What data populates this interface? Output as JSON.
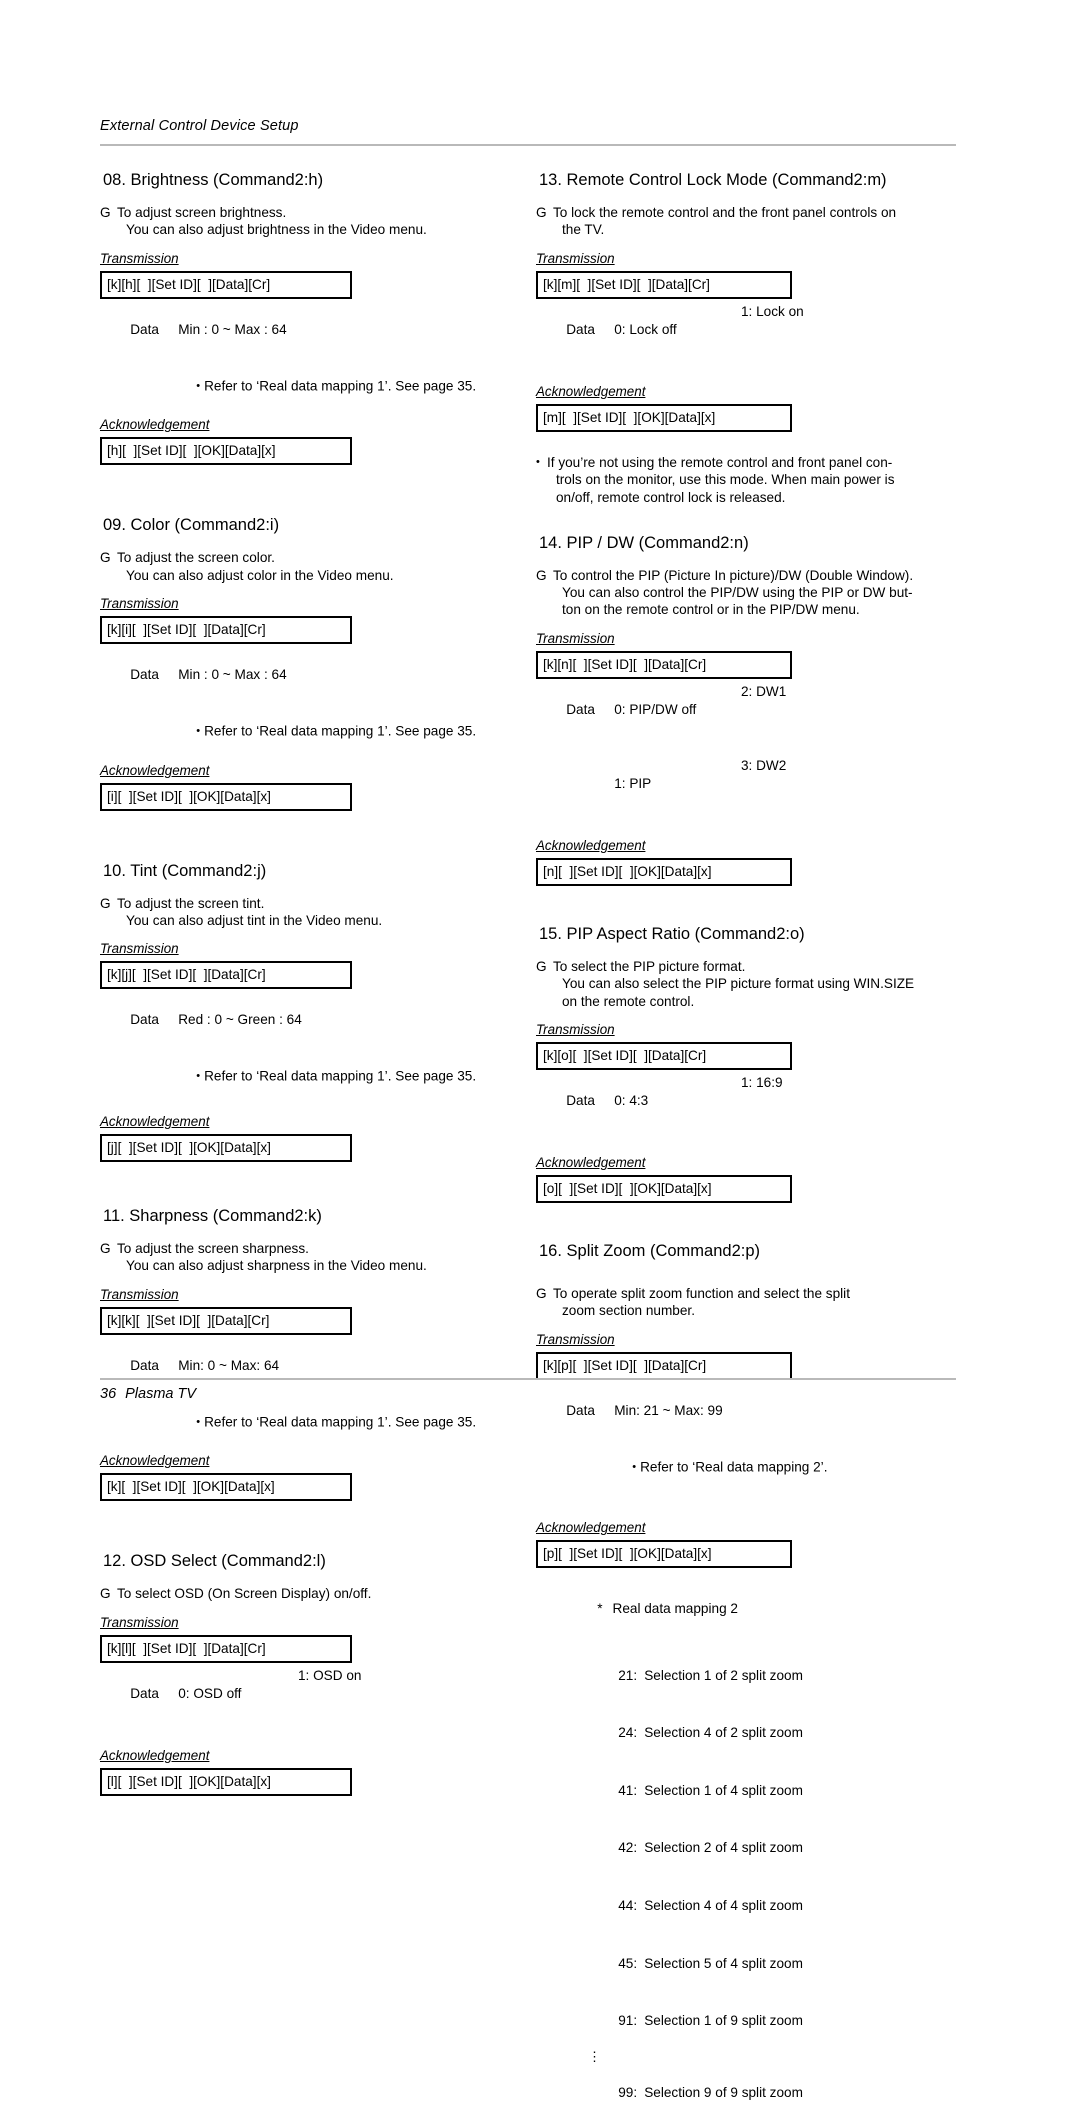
{
  "header": {
    "running_title": "External Control Device Setup"
  },
  "footer": {
    "page_number": "36",
    "product": "Plasma TV"
  },
  "labels": {
    "transmission": "Transmission",
    "acknowledgement": "Acknowledgement",
    "g_mark": "G",
    "bullet": "•",
    "star": "*",
    "data": "Data"
  },
  "left_column": [
    {
      "title": "08. Brightness (Command2:h)",
      "desc_line1": "To adjust screen brightness.",
      "desc_line2": "You can also adjust brightness in the Video menu.",
      "transmission": "[k][h][  ][Set ID][  ][Data][Cr]",
      "data_label": "Data",
      "data_value": "Min : 0 ~ Max : 64",
      "refer": "Refer to ‘Real data mapping 1’. See page 35.",
      "acknowledgement": "[h][  ][Set ID][  ][OK][Data][x]"
    },
    {
      "title": "09. Color (Command2:i)",
      "desc_line1": "To adjust the screen color.",
      "desc_line2": "You can also adjust color in the Video menu.",
      "transmission": "[k][i][  ][Set ID][  ][Data][Cr]",
      "data_label": "Data",
      "data_value": "Min : 0 ~ Max : 64",
      "refer": "Refer to ‘Real data mapping 1’. See page 35.",
      "acknowledgement": "[i][  ][Set ID][  ][OK][Data][x]"
    },
    {
      "title": "10. Tint (Command2:j)",
      "desc_line1": "To adjust the screen tint.",
      "desc_line2": "You can also adjust tint in the Video menu.",
      "transmission": "[k][j][  ][Set ID][  ][Data][Cr]",
      "data_label": "Data",
      "data_value": "Red : 0 ~ Green : 64",
      "refer": "Refer to ‘Real data mapping 1’. See page 35.",
      "acknowledgement": "[j][  ][Set ID][  ][OK][Data][x]"
    },
    {
      "title": "11. Sharpness (Command2:k)",
      "desc_line1": "To adjust the screen sharpness.",
      "desc_line2": "You can also adjust sharpness in the Video menu.",
      "transmission": "[k][k][  ][Set ID][  ][Data][Cr]",
      "data_label": "Data",
      "data_value": "Min: 0 ~ Max: 64",
      "refer": "Refer to ‘Real data mapping 1’. See page 35.",
      "acknowledgement": "[k][  ][Set ID][  ][OK][Data][x]"
    },
    {
      "title": "12. OSD Select (Command2:l)",
      "desc_line1": "To select OSD (On Screen Display) on/off.",
      "transmission": "[k][l][  ][Set ID][  ][Data][Cr]",
      "data_label": "Data",
      "data_value": "0: OSD off",
      "data_value2": "1: OSD on",
      "acknowledgement": "[l][  ][Set ID][  ][OK][Data][x]"
    }
  ],
  "right_column": [
    {
      "title": "13. Remote Control Lock Mode (Command2:m)",
      "desc_line1": "To lock the remote control and the front panel controls on",
      "desc_line2": "the TV.",
      "transmission": "[k][m][  ][Set ID][  ][Data][Cr]",
      "data_label": "Data",
      "data_value": "0: Lock off",
      "data_value2": "1: Lock on",
      "acknowledgement": "[m][  ][Set ID][  ][OK][Data][x]",
      "note_line1": "If you’re not using the remote control and front panel con-",
      "note_line2": "trols on the monitor, use this mode. When main power is",
      "note_line3": "on/off, remote control lock is released."
    },
    {
      "title": "14. PIP / DW (Command2:n)",
      "desc_line1": "To control the PIP (Picture In picture)/DW (Double Window).",
      "desc_line2": "You can also control the PIP/DW using the PIP or DW but-",
      "desc_line3": "ton on the remote control or in the PIP/DW menu.",
      "transmission": "[k][n][  ][Set ID][  ][Data][Cr]",
      "data_label": "Data",
      "data_value": "0: PIP/DW off",
      "data_value2": "2: DW1",
      "data_value3": "1: PIP",
      "data_value4": "3: DW2",
      "acknowledgement": "[n][  ][Set ID][  ][OK][Data][x]"
    },
    {
      "title": "15. PIP Aspect Ratio (Command2:o)",
      "desc_line1": "To select the PIP picture format.",
      "desc_line2": "You can also select the PIP picture format using WIN.SIZE",
      "desc_line3": "on the remote control.",
      "transmission": "[k][o][  ][Set ID][  ][Data][Cr]",
      "data_label": "Data",
      "data_value": "0: 4:3",
      "data_value2": "1: 16:9",
      "acknowledgement": "[o][  ][Set ID][  ][OK][Data][x]"
    },
    {
      "title": "16. Split Zoom (Command2:p)",
      "desc_line1": "To operate split zoom function and select the split",
      "desc_line2": "zoom section number.",
      "transmission": "[k][p][  ][Set ID][  ][Data][Cr]",
      "data_label": "Data",
      "data_value": "Min: 21 ~ Max: 99",
      "refer": "Refer to ‘Real data mapping 2’.",
      "acknowledgement": "[p][  ][Set ID][  ][OK][Data][x]"
    }
  ],
  "real_data_mapping_2": {
    "heading": "Real data mapping 2",
    "rows": [
      {
        "key": "21:",
        "text": "Selection 1 of 2 split zoom"
      },
      {
        "key": "24:",
        "text": "Selection 4 of 2 split zoom"
      },
      {
        "key": "41:",
        "text": "Selection 1 of 4 split zoom"
      },
      {
        "key": "42:",
        "text": "Selection 2 of 4 split zoom"
      },
      {
        "key": "44:",
        "text": "Selection 4 of 4 split zoom"
      },
      {
        "key": "45:",
        "text": "Selection 5 of 4 split zoom"
      },
      {
        "key": "91:",
        "text": "Selection 1 of 9 split zoom"
      }
    ],
    "ellipsis": "⋮",
    "last_row": {
      "key": "99:",
      "text": "Selection 9 of 9 split zoom"
    }
  }
}
